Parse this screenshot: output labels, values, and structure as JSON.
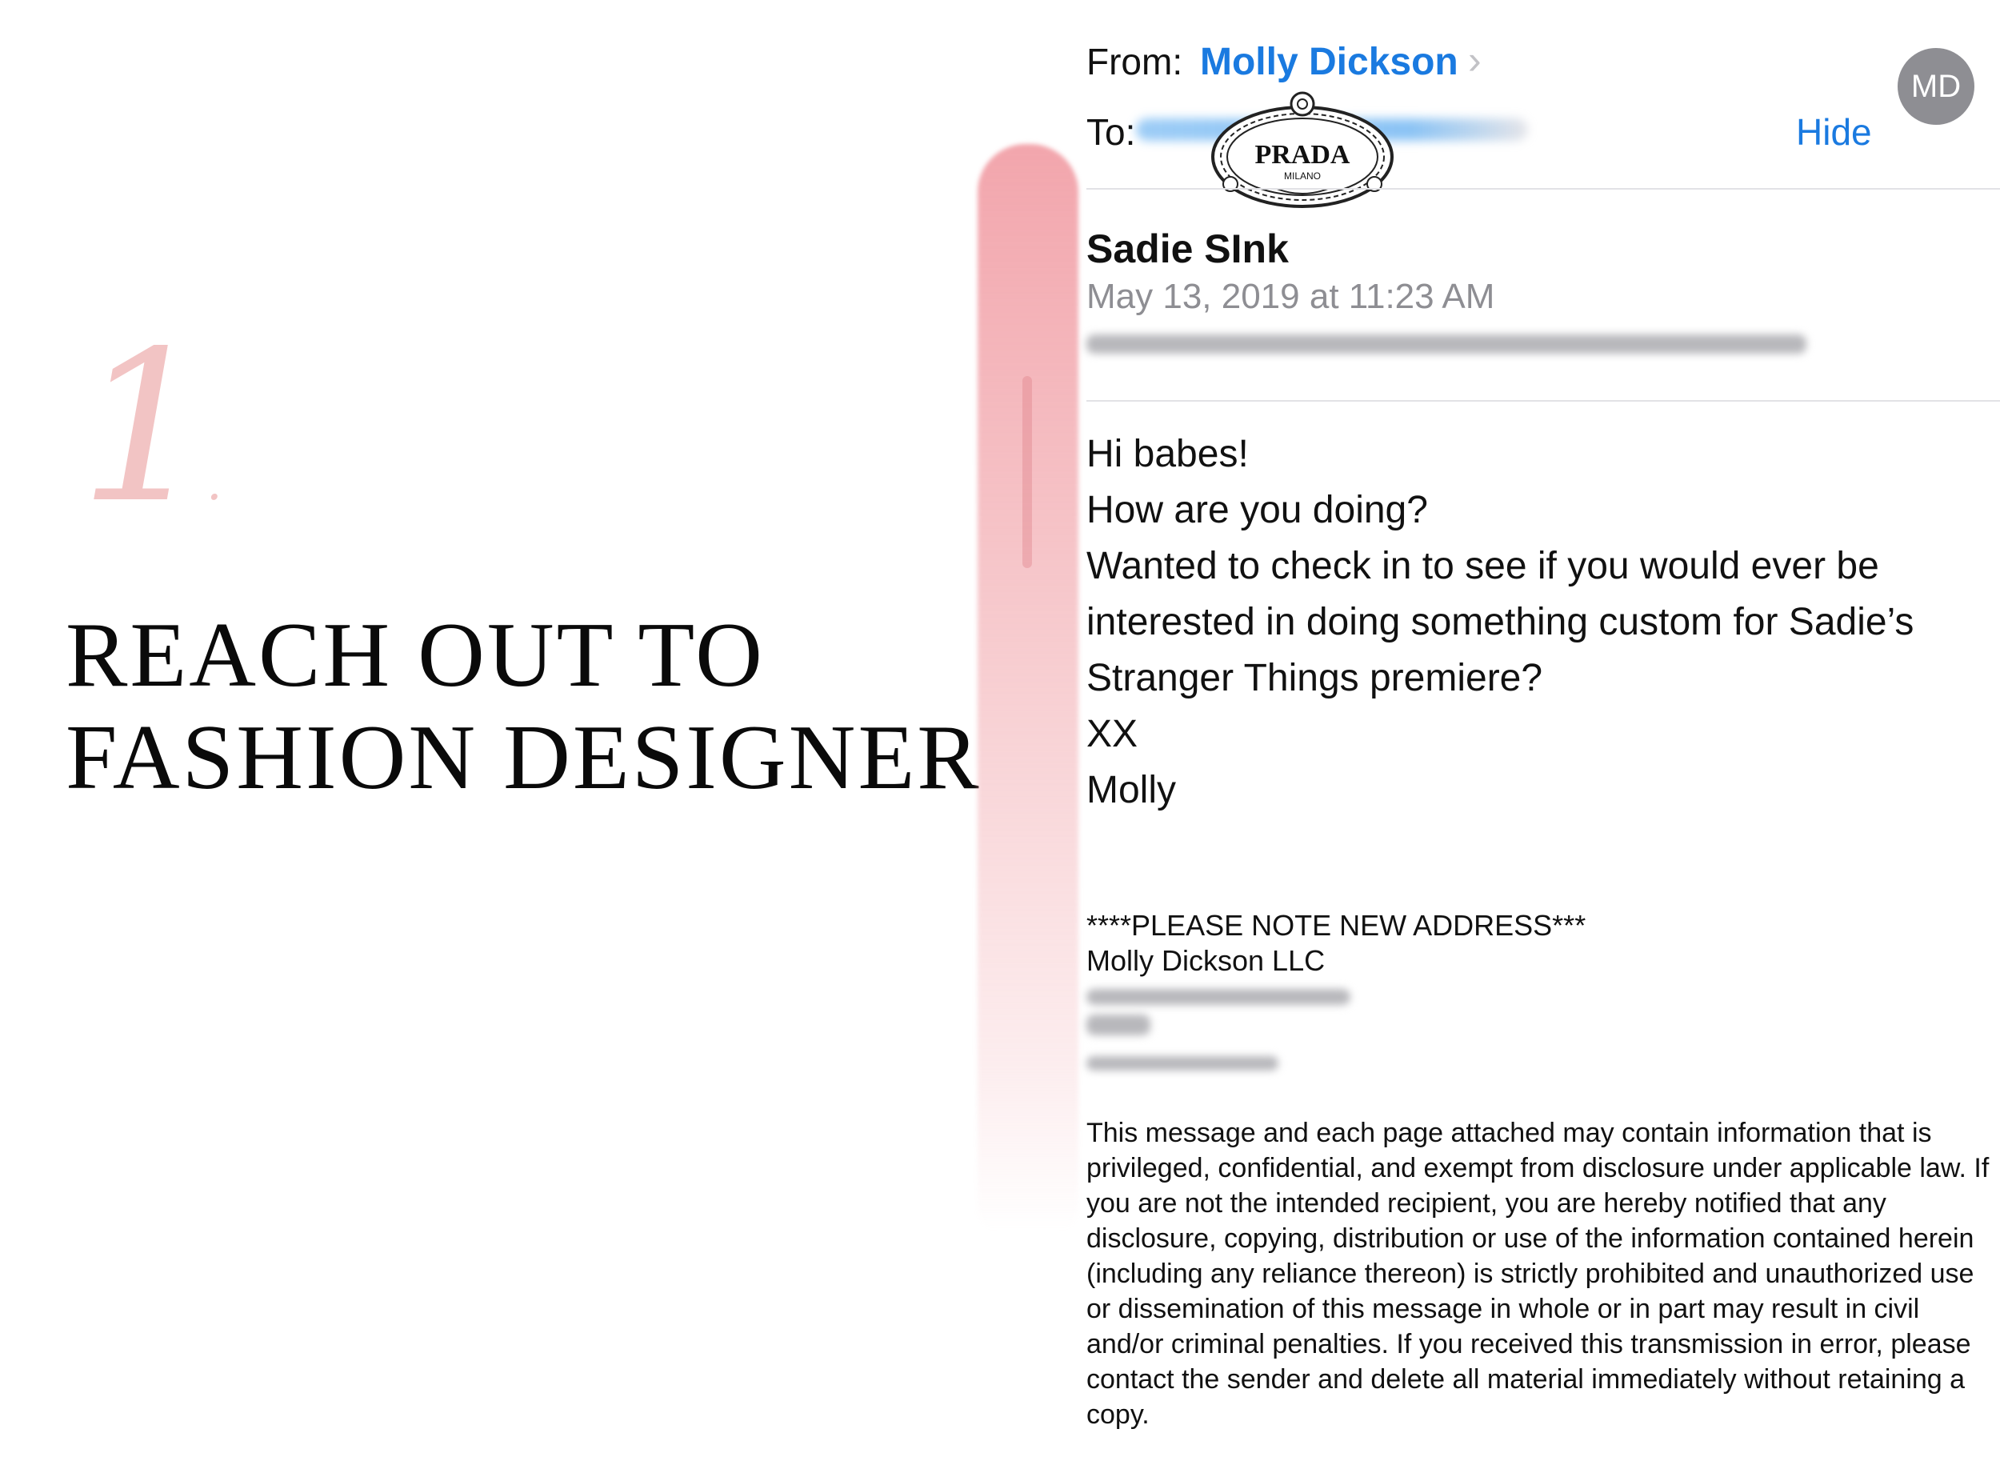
{
  "left": {
    "step_number": "1",
    "headline_line1": "REACH OUT TO",
    "headline_line2": "FASHION DESIGNER"
  },
  "email": {
    "from_label": "From:",
    "from_name": "Molly Dickson",
    "avatar_initials": "MD",
    "to_label": "To:",
    "hide_label": "Hide",
    "logo_text": "PRADA",
    "logo_subtext": "MILANO",
    "subject": "Sadie SInk",
    "date": "May 13, 2019 at 11:23 AM",
    "body": [
      "Hi babes!",
      "How are you doing?",
      "Wanted to check in to see if you would ever be",
      "interested in doing something custom for Sadie’s",
      "Stranger Things premiere?",
      "XX",
      "Molly"
    ],
    "signature_note": "****PLEASE NOTE NEW ADDRESS***",
    "signature_company": "Molly Dickson LLC",
    "legal": "This message and each page attached may contain information that is privileged, confidential, and exempt from disclosure under applicable law. If you are not the intended recipient, you are hereby notified that any disclosure, copying, distribution or use of the information contained herein (including any reliance thereon) is strictly prohibited and unauthorized use or dissemination of this message in whole or in part may result in civil and/or criminal penalties.  If you received this transmission in error, please contact the sender and delete all material immediately without retaining a copy."
  },
  "colors": {
    "link_blue": "#1a7ae0",
    "muted_gray": "#8e8e93",
    "brush_pink": "#f0969e"
  }
}
